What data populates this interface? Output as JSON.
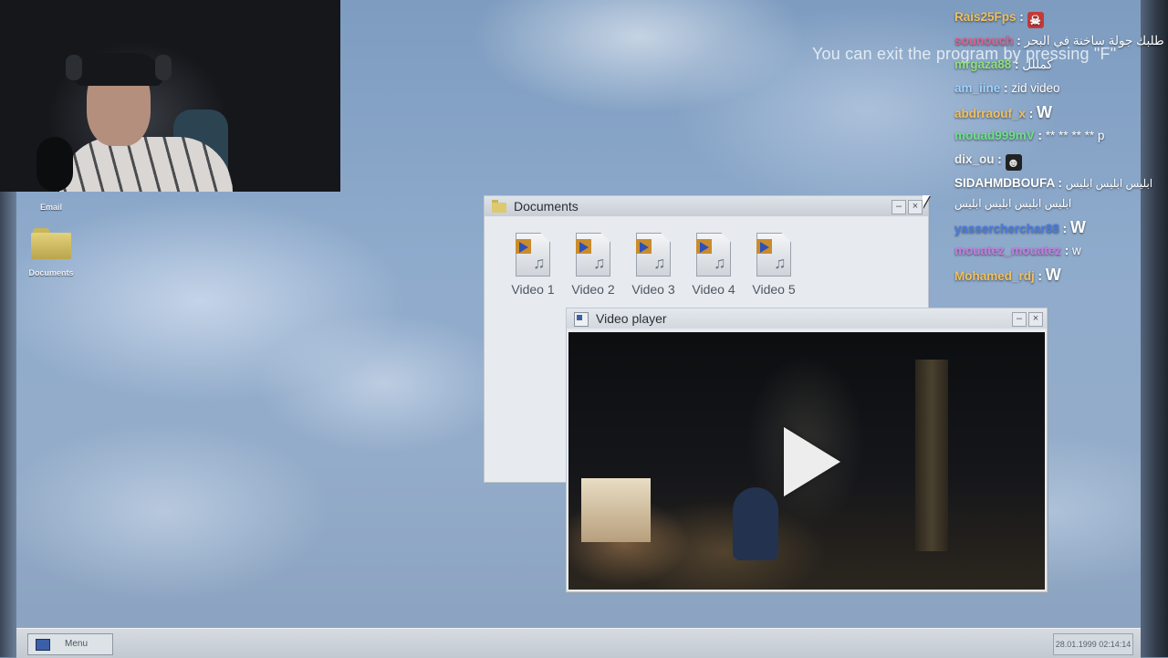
{
  "overlay": {
    "exit_message": "You can exit the program by pressing \"F\""
  },
  "desktop": {
    "icons": [
      {
        "label": "Email",
        "icon": "email-icon"
      },
      {
        "label": "Documents",
        "icon": "folder-icon"
      }
    ]
  },
  "documents_window": {
    "title": "Documents",
    "files": [
      {
        "name": "Video 1",
        "icon": "video-file-icon"
      },
      {
        "name": "Video 2",
        "icon": "video-file-icon"
      },
      {
        "name": "Video 3",
        "icon": "video-file-icon"
      },
      {
        "name": "Video 4",
        "icon": "video-file-icon"
      },
      {
        "name": "Video 5",
        "icon": "video-file-icon"
      }
    ]
  },
  "player_window": {
    "title": "Video player",
    "play_icon": "play-icon"
  },
  "taskbar": {
    "menu_label": "Menu",
    "clock": "28.01.1999 02:14:14"
  },
  "chat": [
    {
      "user": "Rais25Fps",
      "color": "#f0c060",
      "message": "",
      "emote": "devil-emote"
    },
    {
      "user": "sounouch",
      "color": "#e06090",
      "message": "فوبيا طلبك جولة ساخنة في البحر"
    },
    {
      "user": "mrgaza88",
      "color": "#8ee07a",
      "message": "كمللل"
    },
    {
      "user": "am_iine",
      "color": "#9fd3ff",
      "message": "zid video"
    },
    {
      "user": "abdrraouf_x",
      "color": "#f0c060",
      "message": "W"
    },
    {
      "user": "mouad999mV",
      "color": "#6fe08a",
      "message": "** ** ** ** p"
    },
    {
      "user": "dix_ou",
      "color": "#f3f3f3",
      "message": "",
      "emote": "skull-emote"
    },
    {
      "user": "SIDAHMDBOUFA",
      "color": "#ffffff",
      "message": "ابليس ابليس ابليس ابليس ابليس ابليس ابليس"
    },
    {
      "user": "yassercherchar88",
      "color": "#4a7be0",
      "message": "W"
    },
    {
      "user": "mouatez_mouatez",
      "color": "#c77be0",
      "message": "w"
    },
    {
      "user": "Mohamed_rdj",
      "color": "#f0c060",
      "message": "W"
    }
  ]
}
